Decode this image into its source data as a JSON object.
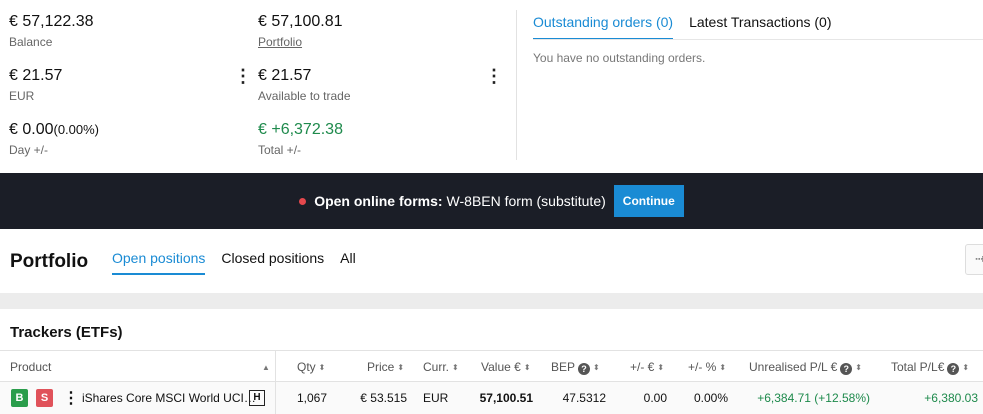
{
  "summary": {
    "balance": {
      "value": "€ 57,122.38",
      "label": "Balance"
    },
    "portfolio": {
      "value": "€ 57,100.81",
      "label": "Portfolio"
    },
    "eur": {
      "value": "€ 21.57",
      "label": "EUR"
    },
    "available": {
      "value": "€ 21.57",
      "label": "Available to trade"
    },
    "day": {
      "value": "€ 0.00",
      "pct": "(0.00%)",
      "label": "Day +/-"
    },
    "total": {
      "value": "€ +6,372.38",
      "label": "Total +/-"
    }
  },
  "orders": {
    "tabs": [
      "Outstanding orders (0)",
      "Latest Transactions (0)"
    ],
    "empty_text": "You have no outstanding orders."
  },
  "banner": {
    "bold": "Open online forms:",
    "text": "W-8BEN form (substitute)",
    "button": "Continue"
  },
  "portfolio": {
    "title": "Portfolio",
    "tabs": [
      "Open positions",
      "Closed positions",
      "All"
    ]
  },
  "section": {
    "title": "Trackers (ETFs)"
  },
  "table": {
    "headers": {
      "product": "Product",
      "qty": "Qty",
      "price": "Price",
      "curr": "Curr.",
      "value": "Value €",
      "bep": "BEP",
      "pl_eur": "+/- €",
      "pl_pct": "+/- %",
      "unrealised": "Unrealised P/L €",
      "total": "Total P/L€"
    },
    "row": {
      "buy": "B",
      "sell": "S",
      "product": "iShares Core MSCI World UCI…",
      "badge": "H",
      "qty": "1,067",
      "price": "€ 53.515",
      "curr": "EUR",
      "value": "57,100.51",
      "bep": "47.5312",
      "pl_eur": "0.00",
      "pl_pct": "0.00%",
      "unrealised": "+6,384.71 (+12.58%)",
      "total": "+6,380.03"
    }
  },
  "colors": {
    "accent": "#1a8bd4",
    "positive": "#1e8a4c",
    "buy": "#2a9d4b",
    "sell": "#e0525a",
    "banner_bg": "#1b1e27"
  }
}
